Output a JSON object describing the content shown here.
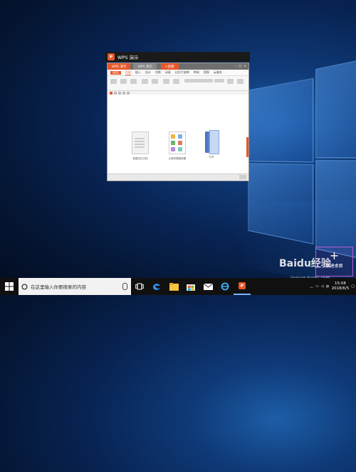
{
  "window": {
    "title": "WPS 演示",
    "app_logo_text": "P"
  },
  "app": {
    "tabs": {
      "home_label": "WPS 演示",
      "doc_label": "WPS 演示",
      "new_tab_label": "+新建"
    },
    "menu_items": [
      "WPS",
      "开始",
      "插入",
      "设计",
      "切换",
      "动画",
      "幻灯片放映",
      "审阅",
      "视图",
      "云服务"
    ],
    "menu_active_index": 1,
    "options": {
      "new_blank": "新建空白文档",
      "from_template": "从更多模板新建",
      "open": "打开"
    }
  },
  "desktop": {
    "new_desktop_plus": "+",
    "new_desktop_label": "新建桌面",
    "watermark_logo": "Baidu经验",
    "watermark_url": "jingyan.baidu.com"
  },
  "taskbar": {
    "search_placeholder": "在这里输入你要搜索的内容",
    "time": "15:08",
    "date": "2018/6/5",
    "language": "中",
    "icons": [
      "task-view-icon",
      "edge-icon",
      "file-explorer-icon",
      "store-icon",
      "mail-icon",
      "ie-icon",
      "wps-presentation-icon"
    ]
  },
  "colors": {
    "wps_orange": "#e8572a",
    "taskbar_bg": "#101010",
    "desktop_blue": "#0a2a5c",
    "new_desktop_border": "#b45bd6"
  }
}
